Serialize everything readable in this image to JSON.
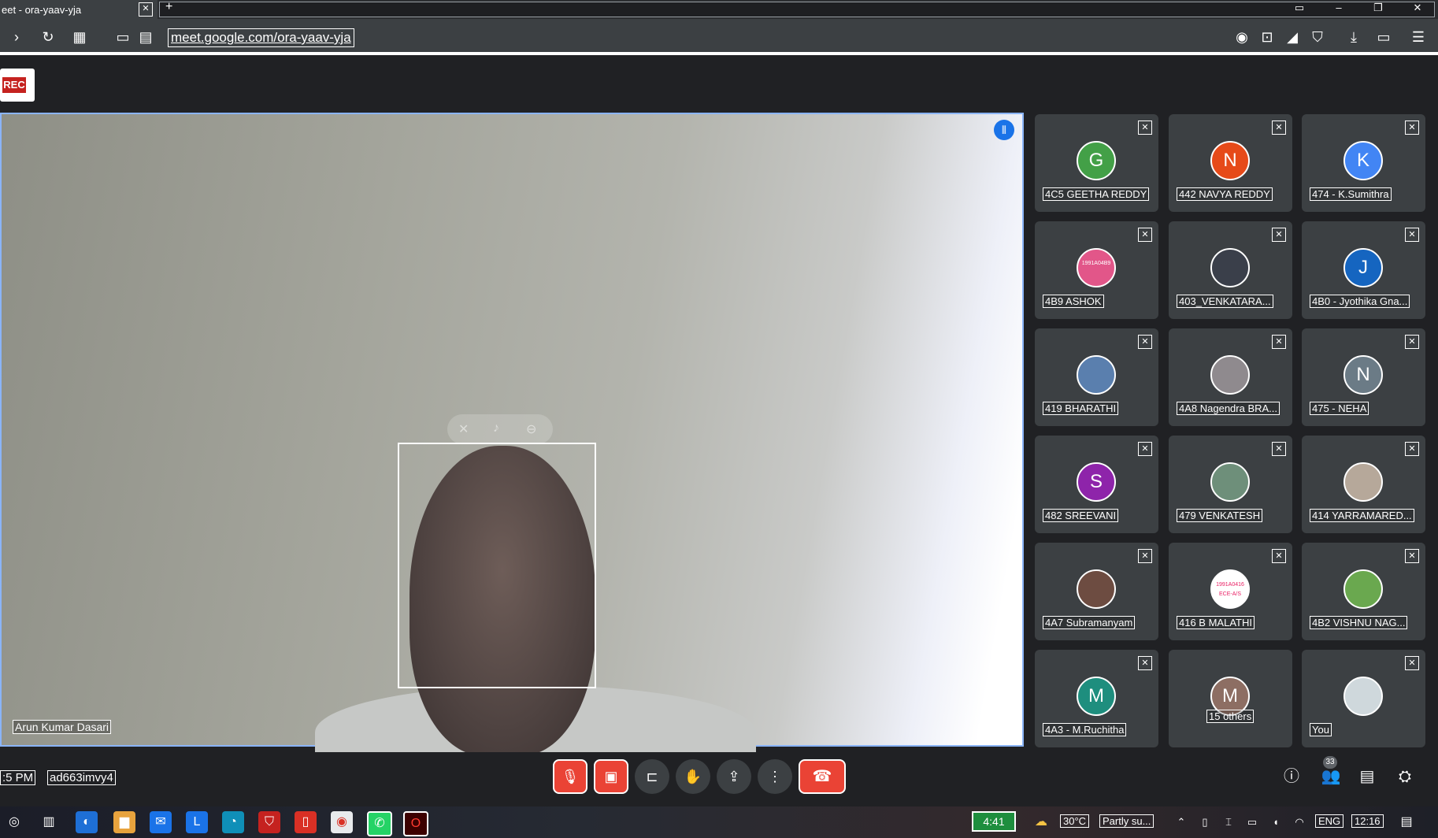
{
  "browser": {
    "tab_title": "eet - ora-yaav-yja",
    "tab_close": "✕",
    "new_tab": "+",
    "url": "meet.google.com/ora-yaav-yja"
  },
  "recording": {
    "label": "REC"
  },
  "main_video": {
    "speaker_name": "Arun Kumar Dasari"
  },
  "participants": [
    {
      "name": "4C5 GEETHA REDDY",
      "initial": "G",
      "color": "#43a047"
    },
    {
      "name": "442 NAVYA REDDY",
      "initial": "N",
      "color": "#e64a19"
    },
    {
      "name": "474 - K.Sumithra",
      "initial": "K",
      "color": "#4285f4"
    },
    {
      "name": "4B9 ASHOK",
      "initial": "1991A04B9",
      "color": "#e25689"
    },
    {
      "name": "403_VENKATARA...",
      "initial": "",
      "color": "#3a3f4a"
    },
    {
      "name": "4B0 - Jyothika Gna...",
      "initial": "J",
      "color": "#1565c0"
    },
    {
      "name": "419 BHARATHI",
      "initial": "",
      "color": "#5a7fae"
    },
    {
      "name": "4A8 Nagendra BRA...",
      "initial": "",
      "color": "#8f8a8e"
    },
    {
      "name": "475 - NEHA",
      "initial": "N",
      "color": "#6b7b86"
    },
    {
      "name": "482 SREEVANI",
      "initial": "S",
      "color": "#8e24aa"
    },
    {
      "name": "479 VENKATESH",
      "initial": "",
      "color": "#6e8f7a"
    },
    {
      "name": "414 YARRAMARED...",
      "initial": "",
      "color": "#b6a89a"
    },
    {
      "name": "4A7 Subramanyam",
      "initial": "",
      "color": "#6d4c41"
    },
    {
      "name": "416 B MALATHI",
      "initial": "1991A0416 ECE-A/S",
      "color": "#ffffff"
    },
    {
      "name": "4B2 VISHNU NAG...",
      "initial": "",
      "color": "#6aa84f"
    },
    {
      "name": "4A3 - M.Ruchitha",
      "initial": "M",
      "color": "#1e8e7e"
    },
    {
      "name": "15 others",
      "initial": "M",
      "color": "#8d6e63"
    },
    {
      "name": "You",
      "initial": "",
      "color": "#cfd8dc"
    }
  ],
  "bottom": {
    "time": ":5 PM",
    "meeting_code": "ad663imvy4",
    "people_count": "33"
  },
  "taskbar": {
    "battery": "4:41",
    "weather": "30°C",
    "weather_desc": "Partly su...",
    "lang": "ENG",
    "clock": "12:16"
  }
}
